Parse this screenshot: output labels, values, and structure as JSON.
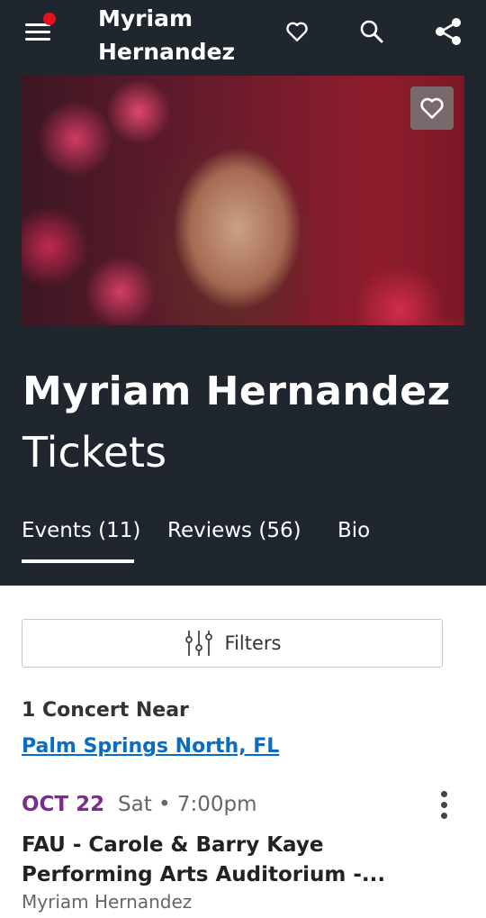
{
  "app_header": {
    "title": "Myriam Hernandez",
    "icons": [
      "menu-icon",
      "heart-icon",
      "search-icon",
      "share-icon"
    ],
    "notification_dot_color": "#e3121c"
  },
  "hero": {
    "favorite_icon": "heart-icon"
  },
  "artist": {
    "name": "Myriam Hernandez",
    "subtitle": "Tickets"
  },
  "tabs": [
    {
      "label": "Events (11)",
      "active": true
    },
    {
      "label": "Reviews (56)",
      "active": false
    },
    {
      "label": "Bio",
      "active": false
    }
  ],
  "filters": {
    "label": "Filters",
    "icon": "sliders-icon"
  },
  "results": {
    "count_text": "1 Concert Near",
    "location": "Palm Springs North, FL"
  },
  "event": {
    "date": "OCT 22",
    "day_time": "Sat • 7:00pm",
    "venue": "FAU - Carole & Barry Kaye Performing Arts Auditorium -...",
    "artist": "Myriam Hernandez",
    "date_color": "#7b2d8e"
  },
  "colors": {
    "header_bg": "#1f262d",
    "link": "#0a6cc2"
  }
}
